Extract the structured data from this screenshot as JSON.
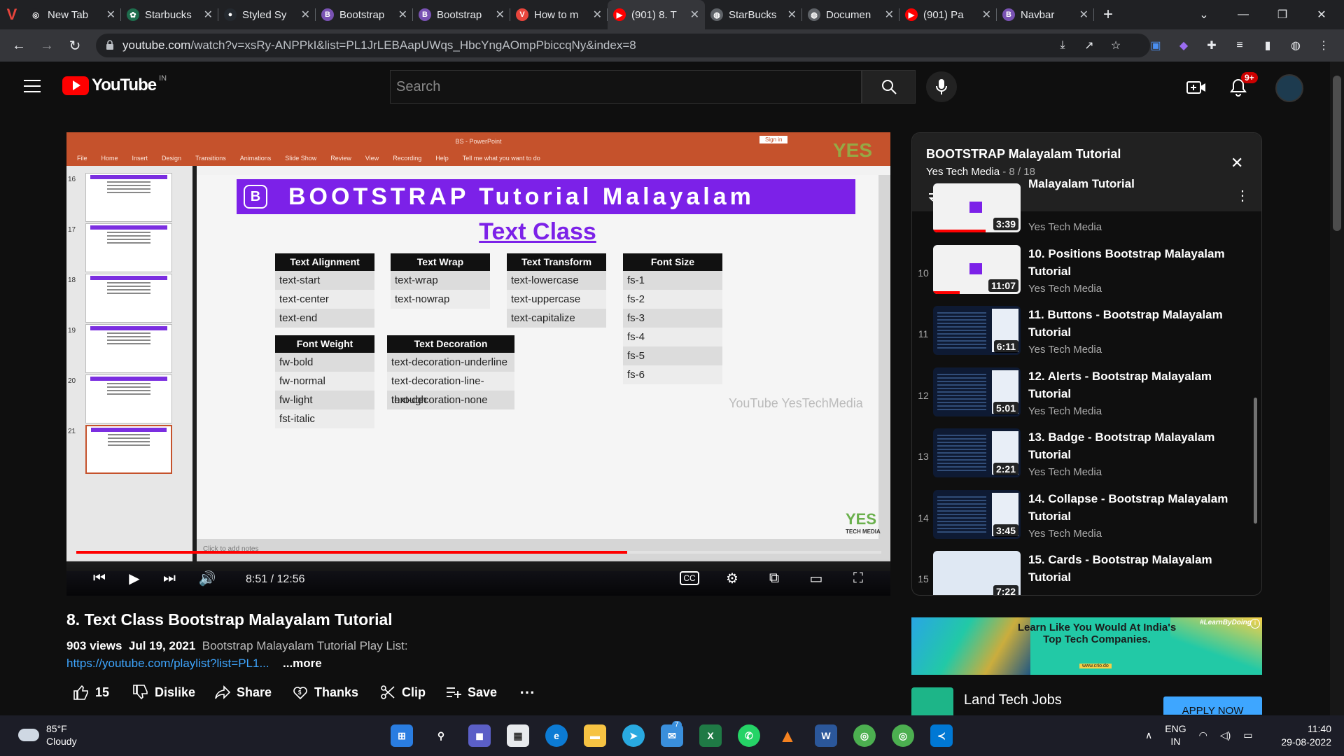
{
  "browser": {
    "tabs": [
      {
        "title": "New Tab",
        "fav_color": "#202124",
        "fav_glyph": "◎"
      },
      {
        "title": "Starbucks",
        "fav_color": "#1e6d4d",
        "fav_glyph": "✿"
      },
      {
        "title": "Styled Sy",
        "fav_color": "#24292f",
        "fav_glyph": "●"
      },
      {
        "title": "Bootstrap",
        "fav_color": "#7952b3",
        "fav_glyph": "B"
      },
      {
        "title": "Bootstrap",
        "fav_color": "#7952b3",
        "fav_glyph": "B"
      },
      {
        "title": "How to m",
        "fav_color": "#e8453c",
        "fav_glyph": "V"
      },
      {
        "title": "(901) 8. T",
        "fav_color": "#ff0000",
        "fav_glyph": "▶"
      },
      {
        "title": "StarBucks",
        "fav_color": "#5f6368",
        "fav_glyph": "◍"
      },
      {
        "title": "Documen",
        "fav_color": "#5f6368",
        "fav_glyph": "◍"
      },
      {
        "title": "(901) Pa",
        "fav_color": "#ff0000",
        "fav_glyph": "▶"
      },
      {
        "title": "Navbar",
        "fav_color": "#7952b3",
        "fav_glyph": "B"
      }
    ],
    "active_tab": 6,
    "url_host": "youtube.com",
    "url_path": "/watch?v=xsRy-ANPPkI&list=PL1JrLEBAapUWqs_HbcYngAOmpPbiccqNy&index=8"
  },
  "youtube": {
    "logo_text": "YouTube",
    "country_code": "IN",
    "search_placeholder": "Search",
    "notification_count": "9+"
  },
  "video": {
    "slide": {
      "app_title": "BS - PowerPoint",
      "menu": [
        "File",
        "Home",
        "Insert",
        "Design",
        "Transitions",
        "Animations",
        "Slide Show",
        "Review",
        "View",
        "Recording",
        "Help",
        "Tell me what you want to do"
      ],
      "signin": "Sign in",
      "banner_icon": "B",
      "banner": "BOOTSTRAP  Tutorial Malayalam",
      "subtitle": "Text Class",
      "tables": [
        {
          "header": "Text Alignment",
          "rows": [
            "text-start",
            "text-center",
            "text-end"
          ]
        },
        {
          "header": "Text Wrap",
          "rows": [
            "text-wrap",
            "text-nowrap"
          ]
        },
        {
          "header": "Text Transform",
          "rows": [
            "text-lowercase",
            "text-uppercase",
            "text-capitalize"
          ]
        },
        {
          "header": "Font Size",
          "rows": [
            "fs-1",
            "fs-2",
            "fs-3",
            "fs-4",
            "fs-5",
            "fs-6"
          ]
        },
        {
          "header": "Font Weight",
          "rows": [
            "fw-bold",
            "fw-normal",
            "fw-light",
            "fst-italic"
          ]
        },
        {
          "header": "Text Decoration",
          "rows": [
            "text-decoration-underline",
            "text-decoration-line-through",
            "text-decoration-none"
          ]
        }
      ],
      "thumb_numbers": [
        "16",
        "17",
        "18",
        "19",
        "20",
        "21"
      ],
      "watermark": "YouTube YesTechMedia",
      "brand": "YES",
      "brand_sub": "TECH MEDIA",
      "notes_placeholder": "Click to add notes"
    },
    "time_current": "8:51",
    "time_total": "12:56",
    "time_display": "8:51 / 12:56",
    "progress": 0.684,
    "title": "8. Text Class Bootstrap Malayalam Tutorial",
    "views": "903 views",
    "date": "Jul 19, 2021",
    "description": "Bootstrap Malayalam Tutorial Play List:",
    "link": "https://youtube.com/playlist?list=PL1...",
    "more": "...more",
    "actions": {
      "likes": "15",
      "dislike": "Dislike",
      "share": "Share",
      "thanks": "Thanks",
      "clip": "Clip",
      "save": "Save"
    }
  },
  "playlist": {
    "title": "BOOTSTRAP Malayalam Tutorial",
    "channel": "Yes Tech Media",
    "position": "8 / 18",
    "items": [
      {
        "index": "",
        "title": "Malayalam Tutorial",
        "channel": "Yes Tech Media",
        "duration": "3:39"
      },
      {
        "index": "10",
        "title": "10. Positions Bootstrap Malayalam Tutorial",
        "channel": "Yes Tech Media",
        "duration": "11:07"
      },
      {
        "index": "11",
        "title": "11. Buttons - Bootstrap Malayalam Tutorial",
        "channel": "Yes Tech Media",
        "duration": "6:11"
      },
      {
        "index": "12",
        "title": "12. Alerts - Bootstrap Malayalam Tutorial",
        "channel": "Yes Tech Media",
        "duration": "5:01"
      },
      {
        "index": "13",
        "title": "13. Badge - Bootstrap Malayalam Tutorial",
        "channel": "Yes Tech Media",
        "duration": "2:21"
      },
      {
        "index": "14",
        "title": "14. Collapse - Bootstrap Malayalam Tutorial",
        "channel": "Yes Tech Media",
        "duration": "3:45"
      },
      {
        "index": "15",
        "title": "15. Cards - Bootstrap Malayalam Tutorial",
        "channel": "",
        "duration": "7:22"
      }
    ]
  },
  "ads": {
    "banner_text": "Learn Like You Would At India's Top Tech Companies.",
    "banner_tag": "#LearnByDoing",
    "banner_small": "www.crio.do",
    "promo_title": "Land Tech Jobs",
    "promo_button": "APPLY NOW"
  },
  "taskbar": {
    "temperature": "85°F",
    "condition": "Cloudy",
    "language": "ENG",
    "region": "IN",
    "time": "11:40",
    "date": "29-08-2022",
    "mail_badge": "7"
  }
}
